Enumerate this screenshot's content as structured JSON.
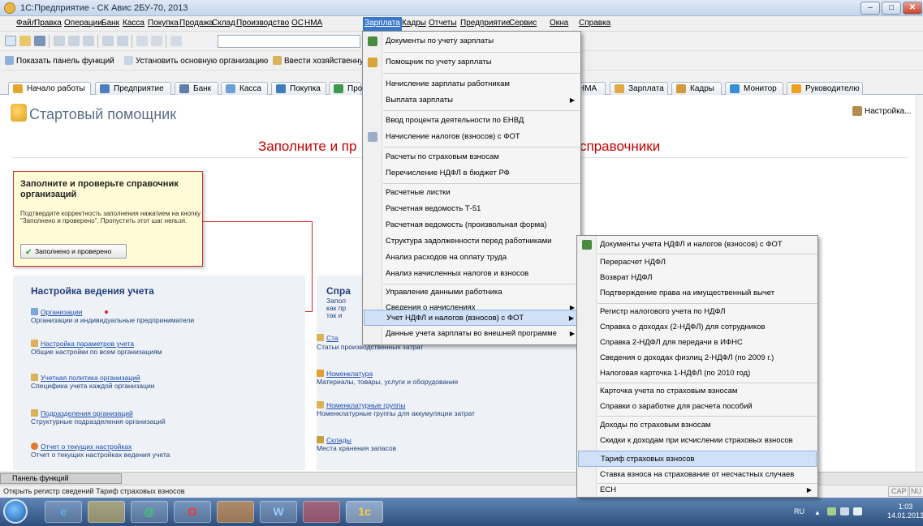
{
  "window": {
    "title": "1С:Предприятие - СК Авис 2БУ-70, 2013",
    "btn_min": "–",
    "btn_max": "□",
    "btn_close": "✕"
  },
  "menubar": [
    "Файл",
    "Правка",
    "Операции",
    "Банк",
    "Касса",
    "Покупка",
    "Продажа",
    "Склад",
    "Производство",
    "ОС",
    "НМА",
    "Зарплата",
    "Кадры",
    "Отчеты",
    "Предприятие",
    "Сервис",
    "Окна",
    "Справка"
  ],
  "toolbar2": {
    "show_panel": "Показать панель функций",
    "set_org": "Установить основную организацию",
    "enter_op": "Ввести хозяйственную"
  },
  "tabs": [
    "Начало работы",
    "Предприятие",
    "Банк",
    "Касса",
    "Покупка",
    "Про",
    "НМА",
    "Зарплата",
    "Кадры",
    "Монитор",
    "Руководителю"
  ],
  "assistant": {
    "title": "Стартовый помощник",
    "settings": "Настройка...",
    "heading_left": "Заполните и пр",
    "heading_right": "справочники"
  },
  "note": {
    "title": "Заполните и проверьте справочник организаций",
    "text": "Подтвердите корректность заполнения нажатием на кнопку \"Заполнено и проверено\". Пропустить этот шаг нельзя.",
    "button": "Заполнено и проверено"
  },
  "left_section": {
    "title": "Настройка ведения учета",
    "items": [
      {
        "link": "Организации",
        "desc": "Организации и индивидуальные предприниматели"
      },
      {
        "link": "Настройка параметров учета",
        "desc": "Общие настройки по всем организациям"
      },
      {
        "link": "Учетная политика организаций",
        "desc": "Специфика учета каждой организации"
      },
      {
        "link": "Подразделения организаций",
        "desc": "Структурные подразделения организаций"
      },
      {
        "link": "Отчет о текущих настройках",
        "desc": "Отчет о текущих настройках ведения учета"
      }
    ]
  },
  "right_section": {
    "title": "Спра",
    "lines": [
      "Запол",
      "как пр",
      "так и"
    ],
    "items": [
      {
        "link": "Ста",
        "desc": "Статьи производственных затрат"
      },
      {
        "link": "Номенклатура",
        "desc": "Материалы, товары, услуги и оборудование"
      },
      {
        "link": "Номенклатурные группы",
        "desc": "Номенклатурные группы для аккумуляции затрат"
      },
      {
        "link": "Склады",
        "desc": "Места хранения запасов"
      }
    ]
  },
  "menu_salary": [
    "Документы по учету зарплаты",
    "Помощник по учету зарплаты",
    "Начисление зарплаты работникам",
    "Выплата зарплаты",
    "Ввод процента деятельности по ЕНВД",
    "Начисление налогов (взносов) с ФОТ",
    "Расчеты по страховым взносам",
    "Перечисление НДФЛ в бюджет РФ",
    "Расчетные листки",
    "Расчетная ведомость Т-51",
    "Расчетная ведомость (произвольная форма)",
    "Структура задолженности перед работниками",
    "Анализ расходов на оплату труда",
    "Анализ начисленных налогов и взносов",
    "Управление данными работника",
    "Сведения о начислениях",
    "Учет НДФЛ и налогов (взносов) с ФОТ",
    "Данные учета зарплаты во внешней программе"
  ],
  "menu_ndfl": [
    "Документы учета НДФЛ и налогов (взносов) с ФОТ",
    "Перерасчет НДФЛ",
    "Возврат НДФЛ",
    "Подтверждение права на имущественный вычет",
    "Регистр налогового учета по НДФЛ",
    "Справка о доходах (2-НДФЛ) для сотрудников",
    "Справка 2-НДФЛ для передачи в ИФНС",
    "Сведения о доходах физлиц 2-НДФЛ (по 2009 г.)",
    "Налоговая карточка 1-НДФЛ (по 2010 год)",
    "Карточка учета по страховым взносам",
    "Справки о заработке для расчета пособий",
    "Доходы по страховым взносам",
    "Скидки к доходам при исчислении страховых взносов",
    "Тариф страховых взносов",
    "Ставка взноса на страхование от несчастных случаев",
    "ЕСН"
  ],
  "func_panel": "Панель функций",
  "status": {
    "text": "Открыть регистр сведений Тариф страховых взносов",
    "cap": "CAP",
    "num": "NU"
  },
  "taskbar": {
    "lang": "RU",
    "time": "1:03",
    "date": "14.01.2013",
    "items": [
      "e",
      "",
      "@",
      "O",
      "",
      "W",
      "",
      "1c"
    ]
  }
}
